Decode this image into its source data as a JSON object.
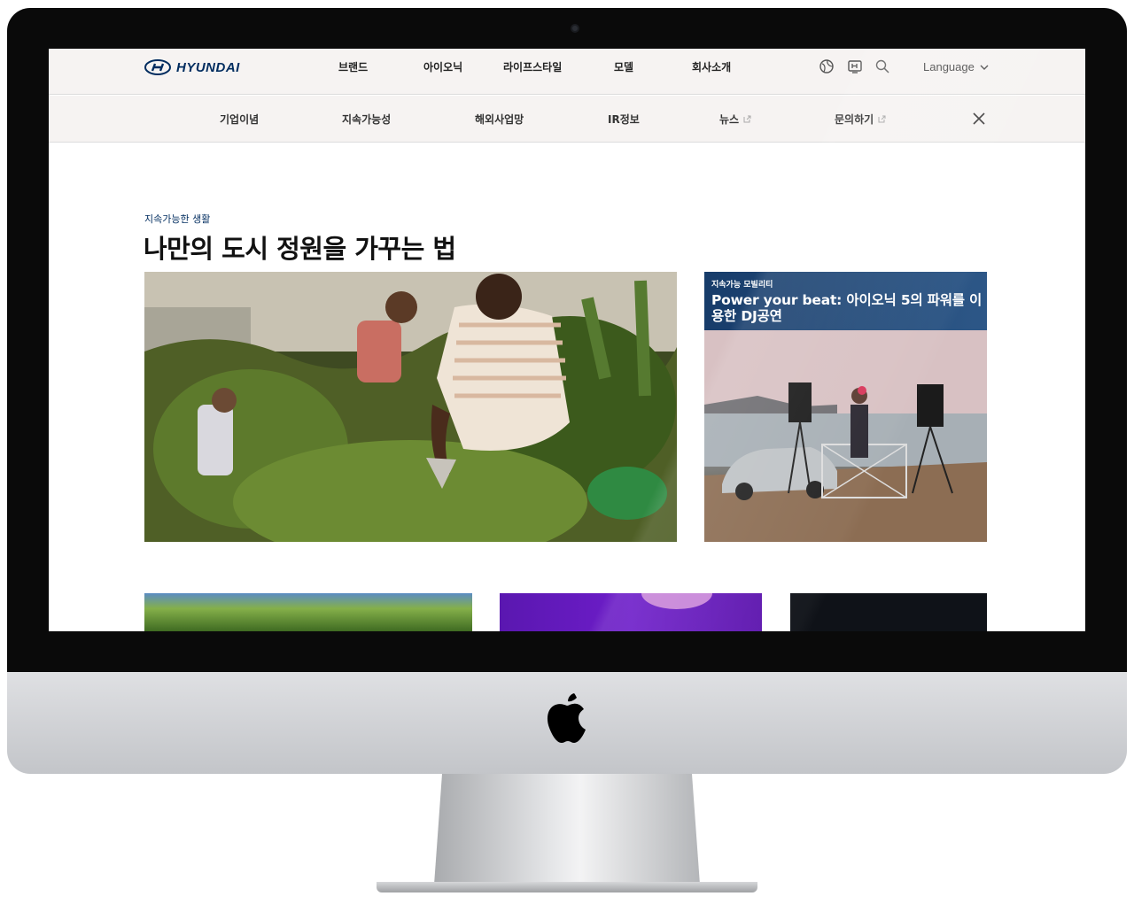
{
  "header": {
    "logo_text": "HYUNDAI",
    "menu": [
      "브랜드",
      "아이오닉",
      "라이프스타일",
      "모델",
      "회사소개"
    ],
    "language_label": "Language",
    "icons": [
      "global-icon",
      "media-icon",
      "search-icon",
      "chevron-down-icon"
    ]
  },
  "subnav": {
    "items": [
      {
        "label": "기업이념",
        "external": false
      },
      {
        "label": "지속가능성",
        "external": false
      },
      {
        "label": "해외사업망",
        "external": false
      },
      {
        "label": "IR정보",
        "external": false
      },
      {
        "label": "뉴스",
        "external": true
      },
      {
        "label": "문의하기",
        "external": true
      }
    ]
  },
  "article": {
    "category": "지속가능한 생활",
    "title": "나만의 도시 정원을 가꾸는 법"
  },
  "side_card": {
    "tag": "지속가능 모빌리티",
    "title": "Power your beat: 아이오닉 5의 파워를 이용한 DJ공연"
  },
  "colors": {
    "brand": "#002c5f",
    "nav_bg": "#f6f3f2",
    "card_banner": "#1f4677"
  }
}
